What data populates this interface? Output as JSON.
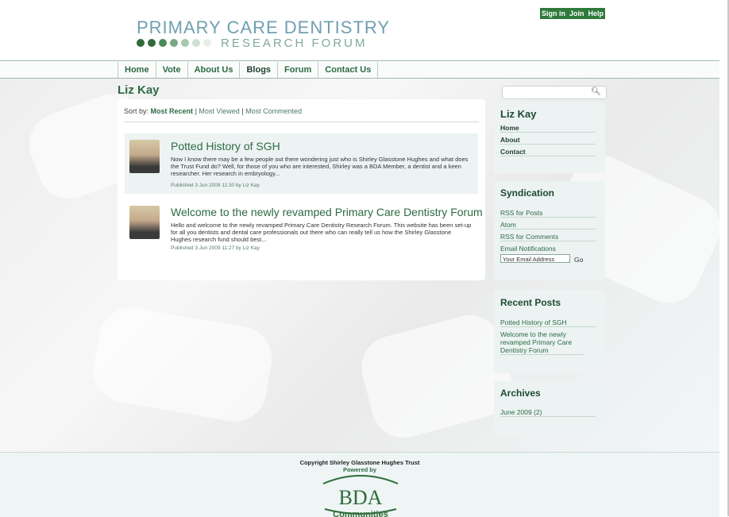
{
  "header": {
    "logo_title": "PRIMARY CARE DENTISTRY",
    "logo_subtitle": "RESEARCH FORUM",
    "dot_colors": [
      "#2f6b3a",
      "#2f6b3a",
      "#4a8a56",
      "#7aa783",
      "#a9c6ae",
      "#cfdfd2",
      "#e6efe8"
    ],
    "account_links": [
      "Sign in",
      "Join",
      "Help"
    ]
  },
  "nav": {
    "items": [
      "Home",
      "Vote",
      "About Us",
      "Blogs",
      "Forum",
      "Contact Us"
    ]
  },
  "page": {
    "title": "Liz Kay",
    "sort_label": "Sort by:",
    "sort_options": [
      "Most Recent",
      "Most Viewed",
      "Most Commented"
    ],
    "sort_separator": "|"
  },
  "posts": [
    {
      "title": "Potted History of SGH",
      "body": "Now I know there may be a few people out there wondering just who is Shirley Glasstone Hughes and what does the Trust Fund do? Well, for those of you who are interested, Shirley was a BDA Member, a dentist and a keen researcher. Her research in embryology...",
      "meta": "Published 3 Jun 2009 11:30 by Liz Kay"
    },
    {
      "title": "Welcome to the newly revamped Primary Care Dentistry Forum",
      "body": "Hello and welcome to the newly revamped Primary Care Dentistry Research Forum. This website has been set-up for all you dentists and dental care professionals out there who can really tell us how the Shirley Glasstone Hughes research fund should best...",
      "meta": "Published 3 Jun 2009 11:27 by Liz Kay"
    }
  ],
  "sidebar": {
    "search_icon": "search-icon",
    "profile": {
      "title": "Liz Kay",
      "links": [
        "Home",
        "About",
        "Contact"
      ]
    },
    "syndication": {
      "title": "Syndication",
      "links": [
        "RSS for Posts",
        "Atom",
        "RSS for Comments",
        "Email Notifications"
      ],
      "email_value": "Your Email Address",
      "go_label": "Go"
    },
    "recent_posts": {
      "title": "Recent Posts",
      "links": [
        "Potted History of SGH",
        "Welcome to the newly revamped Primary Care Dentistry Forum"
      ]
    },
    "archives": {
      "title": "Archives",
      "links": [
        "June 2009 (2)"
      ]
    }
  },
  "footer": {
    "copyright": "Copyright Shirley Glasstone Hughes Trust",
    "powered_by": "Powered by",
    "logo_text": "BDA",
    "logo_subtext": "Communities"
  }
}
